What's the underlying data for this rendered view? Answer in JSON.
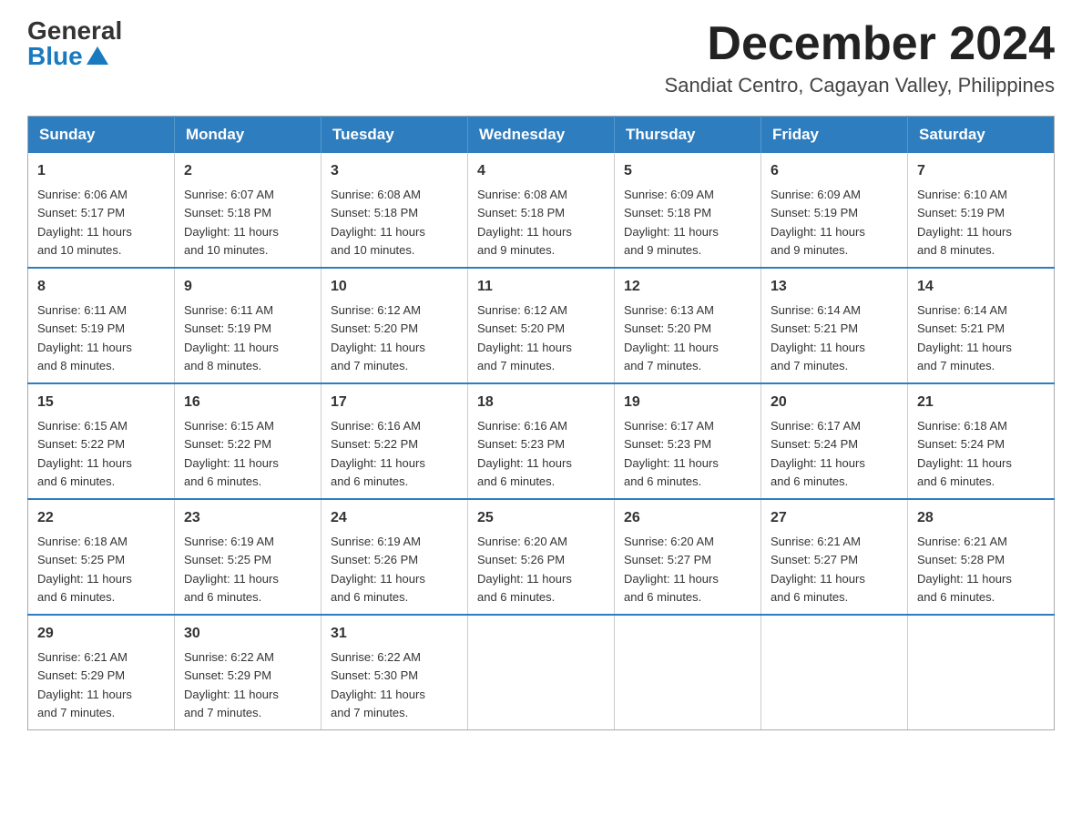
{
  "logo": {
    "general": "General",
    "blue": "Blue"
  },
  "title": "December 2024",
  "location": "Sandiat Centro, Cagayan Valley, Philippines",
  "days_of_week": [
    "Sunday",
    "Monday",
    "Tuesday",
    "Wednesday",
    "Thursday",
    "Friday",
    "Saturday"
  ],
  "weeks": [
    [
      {
        "day": "1",
        "sunrise": "6:06 AM",
        "sunset": "5:17 PM",
        "daylight": "11 hours and 10 minutes."
      },
      {
        "day": "2",
        "sunrise": "6:07 AM",
        "sunset": "5:18 PM",
        "daylight": "11 hours and 10 minutes."
      },
      {
        "day": "3",
        "sunrise": "6:08 AM",
        "sunset": "5:18 PM",
        "daylight": "11 hours and 10 minutes."
      },
      {
        "day": "4",
        "sunrise": "6:08 AM",
        "sunset": "5:18 PM",
        "daylight": "11 hours and 9 minutes."
      },
      {
        "day": "5",
        "sunrise": "6:09 AM",
        "sunset": "5:18 PM",
        "daylight": "11 hours and 9 minutes."
      },
      {
        "day": "6",
        "sunrise": "6:09 AM",
        "sunset": "5:19 PM",
        "daylight": "11 hours and 9 minutes."
      },
      {
        "day": "7",
        "sunrise": "6:10 AM",
        "sunset": "5:19 PM",
        "daylight": "11 hours and 8 minutes."
      }
    ],
    [
      {
        "day": "8",
        "sunrise": "6:11 AM",
        "sunset": "5:19 PM",
        "daylight": "11 hours and 8 minutes."
      },
      {
        "day": "9",
        "sunrise": "6:11 AM",
        "sunset": "5:19 PM",
        "daylight": "11 hours and 8 minutes."
      },
      {
        "day": "10",
        "sunrise": "6:12 AM",
        "sunset": "5:20 PM",
        "daylight": "11 hours and 7 minutes."
      },
      {
        "day": "11",
        "sunrise": "6:12 AM",
        "sunset": "5:20 PM",
        "daylight": "11 hours and 7 minutes."
      },
      {
        "day": "12",
        "sunrise": "6:13 AM",
        "sunset": "5:20 PM",
        "daylight": "11 hours and 7 minutes."
      },
      {
        "day": "13",
        "sunrise": "6:14 AM",
        "sunset": "5:21 PM",
        "daylight": "11 hours and 7 minutes."
      },
      {
        "day": "14",
        "sunrise": "6:14 AM",
        "sunset": "5:21 PM",
        "daylight": "11 hours and 7 minutes."
      }
    ],
    [
      {
        "day": "15",
        "sunrise": "6:15 AM",
        "sunset": "5:22 PM",
        "daylight": "11 hours and 6 minutes."
      },
      {
        "day": "16",
        "sunrise": "6:15 AM",
        "sunset": "5:22 PM",
        "daylight": "11 hours and 6 minutes."
      },
      {
        "day": "17",
        "sunrise": "6:16 AM",
        "sunset": "5:22 PM",
        "daylight": "11 hours and 6 minutes."
      },
      {
        "day": "18",
        "sunrise": "6:16 AM",
        "sunset": "5:23 PM",
        "daylight": "11 hours and 6 minutes."
      },
      {
        "day": "19",
        "sunrise": "6:17 AM",
        "sunset": "5:23 PM",
        "daylight": "11 hours and 6 minutes."
      },
      {
        "day": "20",
        "sunrise": "6:17 AM",
        "sunset": "5:24 PM",
        "daylight": "11 hours and 6 minutes."
      },
      {
        "day": "21",
        "sunrise": "6:18 AM",
        "sunset": "5:24 PM",
        "daylight": "11 hours and 6 minutes."
      }
    ],
    [
      {
        "day": "22",
        "sunrise": "6:18 AM",
        "sunset": "5:25 PM",
        "daylight": "11 hours and 6 minutes."
      },
      {
        "day": "23",
        "sunrise": "6:19 AM",
        "sunset": "5:25 PM",
        "daylight": "11 hours and 6 minutes."
      },
      {
        "day": "24",
        "sunrise": "6:19 AM",
        "sunset": "5:26 PM",
        "daylight": "11 hours and 6 minutes."
      },
      {
        "day": "25",
        "sunrise": "6:20 AM",
        "sunset": "5:26 PM",
        "daylight": "11 hours and 6 minutes."
      },
      {
        "day": "26",
        "sunrise": "6:20 AM",
        "sunset": "5:27 PM",
        "daylight": "11 hours and 6 minutes."
      },
      {
        "day": "27",
        "sunrise": "6:21 AM",
        "sunset": "5:27 PM",
        "daylight": "11 hours and 6 minutes."
      },
      {
        "day": "28",
        "sunrise": "6:21 AM",
        "sunset": "5:28 PM",
        "daylight": "11 hours and 6 minutes."
      }
    ],
    [
      {
        "day": "29",
        "sunrise": "6:21 AM",
        "sunset": "5:29 PM",
        "daylight": "11 hours and 7 minutes."
      },
      {
        "day": "30",
        "sunrise": "6:22 AM",
        "sunset": "5:29 PM",
        "daylight": "11 hours and 7 minutes."
      },
      {
        "day": "31",
        "sunrise": "6:22 AM",
        "sunset": "5:30 PM",
        "daylight": "11 hours and 7 minutes."
      },
      null,
      null,
      null,
      null
    ]
  ],
  "labels": {
    "sunrise": "Sunrise:",
    "sunset": "Sunset:",
    "daylight": "Daylight:"
  }
}
